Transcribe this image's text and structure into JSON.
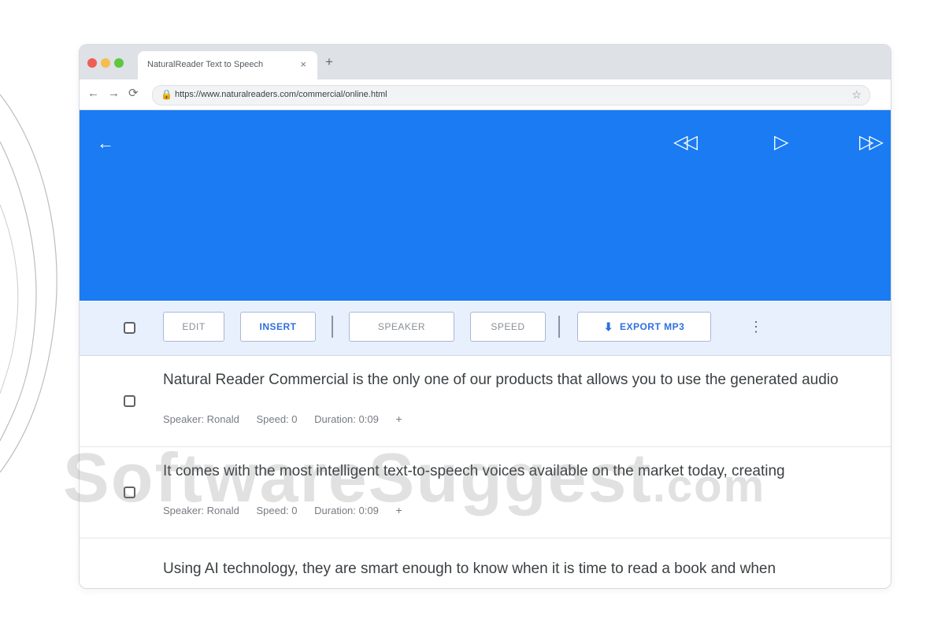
{
  "browser": {
    "tab_title": "NaturalReader Text to Speech",
    "tab_close": "×",
    "new_tab": "+",
    "url": "https://www.naturalreaders.com/commercial/online.html",
    "nav_back": "←",
    "nav_forward": "→",
    "nav_reload": "⟳"
  },
  "player": {
    "back": "←",
    "rewind": "◁◁",
    "play": "▷",
    "forward": "▷▷"
  },
  "actions": {
    "edit_label": "EDIT",
    "insert_label": "INSERT",
    "speaker_label": "SPEAKER",
    "speed_label": "SPEED",
    "export_label": "EXPORT MP3",
    "more": "⋮"
  },
  "rows": [
    {
      "text": "Natural Reader Commercial is the only one of our products that allows you to use the generated audio",
      "speaker": "Speaker: Ronald",
      "speed": "Speed: 0",
      "duration": "Duration: 0:09",
      "add": "+"
    },
    {
      "text": "It comes with the most intelligent text-to-speech voices available on the market today, creating",
      "speaker": "Speaker: Ronald",
      "speed": "Speed: 0",
      "duration": "Duration: 0:09",
      "add": "+"
    },
    {
      "text": "Using AI technology, they are smart enough to know when it is time to read a book and when",
      "speaker": "",
      "speed": "",
      "duration": "",
      "add": ""
    }
  ],
  "watermark": {
    "main": "SoftwareSuggest",
    "suffix": ".com"
  },
  "colors": {
    "player_bg": "#1a7bf2",
    "actionbar_bg": "#e8f0fe",
    "accent": "#2f6fe0"
  }
}
